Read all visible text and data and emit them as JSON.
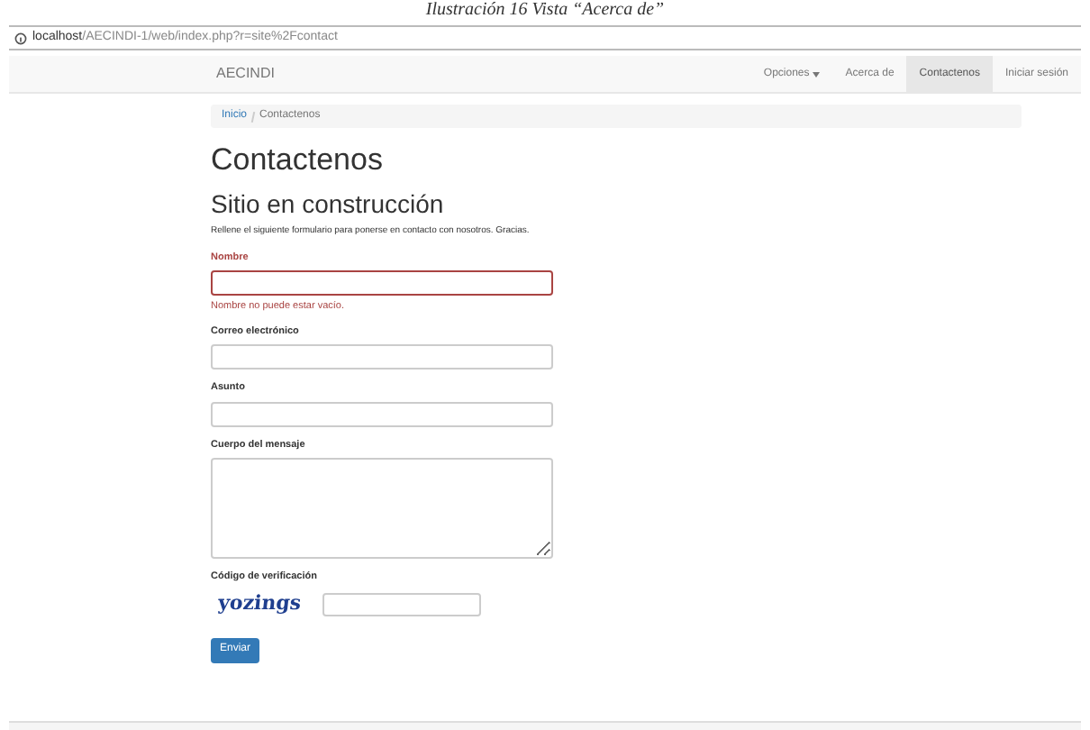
{
  "caption": "Ilustración 16 Vista “Acerca de”",
  "address_bar": {
    "host": "localhost",
    "path": "/AECINDI-1/web/index.php?r=site%2Fcontact"
  },
  "navbar": {
    "brand": "AECINDI",
    "items": [
      {
        "label": "Opciones",
        "dropdown": true,
        "selected": false
      },
      {
        "label": "Acerca de",
        "dropdown": false,
        "selected": false
      },
      {
        "label": "Contactenos",
        "dropdown": false,
        "selected": true
      },
      {
        "label": "Iniciar sesión",
        "dropdown": false,
        "selected": false
      }
    ]
  },
  "breadcrumb": [
    {
      "label": "Inicio",
      "link": true
    },
    {
      "label": "Contactenos",
      "link": false
    }
  ],
  "title": "Contactenos",
  "subtitle": "Sitio en construcción",
  "intro": "Rellene el siguiente formulario para ponerse en contacto con nosotros. Gracias.",
  "fields": [
    {
      "label": "Nombre",
      "kind": "input",
      "error": "Nombre no puede estar vacío."
    },
    {
      "label": "Correo electrónico",
      "kind": "input"
    },
    {
      "label": "Asunto",
      "kind": "input"
    },
    {
      "label": "Cuerpo del mensaje",
      "kind": "textarea"
    },
    {
      "label": "Código de verificación",
      "kind": "captcha",
      "captcha": "yozings"
    }
  ],
  "submit": "Enviar"
}
